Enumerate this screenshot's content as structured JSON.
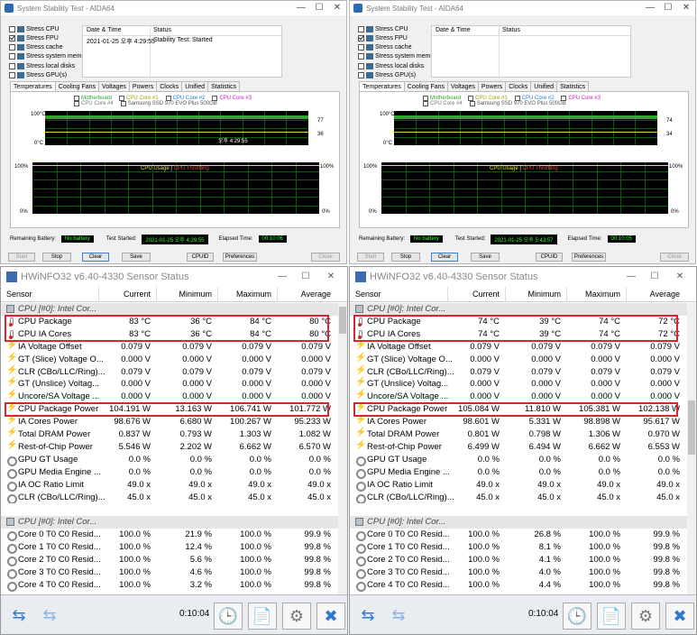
{
  "aida": {
    "title": "System Stability Test - AIDA64",
    "win_min": "—",
    "win_max": "☐",
    "win_close": "✕",
    "options": [
      "Stress CPU",
      "Stress FPU",
      "Stress cache",
      "Stress system memory",
      "Stress local disks",
      "Stress GPU(s)"
    ],
    "options_checked": [
      false,
      true,
      false,
      false,
      false,
      false
    ],
    "log_headers": {
      "date": "Date & Time",
      "status": "Status"
    },
    "tabs": [
      "Temperatures",
      "Cooling Fans",
      "Voltages",
      "Powers",
      "Clocks",
      "Unified",
      "Statistics"
    ],
    "legend": [
      "Motherboard",
      "CPU Core #1",
      "CPU Core #2",
      "CPU Core #3",
      "CPU Core #4",
      "Samsung SSD 970 EVO Plus 500GB"
    ],
    "legend_colors": [
      "#2e9d2e",
      "#9f9f00",
      "#1e7fd0",
      "#c020c0",
      "#777777",
      "#555555"
    ],
    "graph1_top": "100°C",
    "graph1_bottom": "0°C",
    "graph2_title_a": "CPU Usage",
    "graph2_sep": " | ",
    "graph2_title_b": "CPU Throttling",
    "graph2_top_left": "100%",
    "graph2_bottom_left": "0%",
    "graph2_top_right": "100%",
    "graph2_bottom_right": "0%",
    "labels": {
      "battery": "Remaining Battery:",
      "started": "Test Started:",
      "elapsed": "Elapsed Time:"
    },
    "buttons": [
      "Start",
      "Stop",
      "Clear",
      "Save",
      "CPUID",
      "Preferences",
      "Close"
    ],
    "left": {
      "log_date": "2021-01-25 오후 4:29:55",
      "log_status": "Stability Test: Started",
      "readout_a": "77",
      "readout_b": "36",
      "time_marker": "오후 4:29:55",
      "battery": "No battery",
      "started": "2021-01-25 오후 4:29:55",
      "elapsed": "00:10:06"
    },
    "right": {
      "log_date": "",
      "log_status": "",
      "readout_a": "74",
      "readout_b": "34",
      "time_marker": "",
      "battery": "No battery",
      "started": "2021-01-25 오후 5:43:57",
      "elapsed": "00:10:05"
    }
  },
  "hw": {
    "title": "HWiNFO32 v6.40-4330 Sensor Status",
    "win_min": "—",
    "win_max": "☐",
    "win_close": "✕",
    "headers": {
      "sensor": "Sensor",
      "current": "Current",
      "minimum": "Minimum",
      "maximum": "Maximum",
      "average": "Average"
    },
    "footer_nav": "⇆",
    "footer_nav2": "⇆",
    "footer_clock": "🕒",
    "footer_report": "📄",
    "footer_gear": "⚙",
    "footer_close": "✖",
    "left": {
      "timer": "0:10:04",
      "rows": [
        {
          "t": "group",
          "name": "CPU [#0]: Intel Cor..."
        },
        {
          "t": "therm",
          "name": "CPU Package",
          "cur": "83 °C",
          "min": "36 °C",
          "max": "84 °C",
          "avg": "80 °C"
        },
        {
          "t": "therm",
          "name": "CPU IA Cores",
          "cur": "83 °C",
          "min": "36 °C",
          "max": "84 °C",
          "avg": "80 °C"
        },
        {
          "t": "bolt",
          "name": "IA Voltage Offset",
          "cur": "0.079 V",
          "min": "0.079 V",
          "max": "0.079 V",
          "avg": "0.079 V"
        },
        {
          "t": "bolt",
          "name": "GT (Slice) Voltage O...",
          "cur": "0.000 V",
          "min": "0.000 V",
          "max": "0.000 V",
          "avg": "0.000 V"
        },
        {
          "t": "bolt",
          "name": "CLR (CBo/LLC/Ring)...",
          "cur": "0.079 V",
          "min": "0.079 V",
          "max": "0.079 V",
          "avg": "0.079 V"
        },
        {
          "t": "bolt",
          "name": "GT (Unslice) Voltag...",
          "cur": "0.000 V",
          "min": "0.000 V",
          "max": "0.000 V",
          "avg": "0.000 V"
        },
        {
          "t": "bolt",
          "name": "Uncore/SA Voltage ...",
          "cur": "0.000 V",
          "min": "0.000 V",
          "max": "0.000 V",
          "avg": "0.000 V"
        },
        {
          "t": "bolt",
          "name": "CPU Package Power",
          "cur": "104.191 W",
          "min": "13.163 W",
          "max": "106.741 W",
          "avg": "101.772 W"
        },
        {
          "t": "bolt",
          "name": "IA Cores Power",
          "cur": "98.676 W",
          "min": "6.680 W",
          "max": "100.267 W",
          "avg": "95.233 W"
        },
        {
          "t": "bolt",
          "name": "Total DRAM Power",
          "cur": "0.837 W",
          "min": "0.793 W",
          "max": "1.303 W",
          "avg": "1.082 W"
        },
        {
          "t": "bolt",
          "name": "Rest-of-Chip Power",
          "cur": "5.546 W",
          "min": "2.202 W",
          "max": "6.662 W",
          "avg": "6.570 W"
        },
        {
          "t": "gear",
          "name": "GPU GT Usage",
          "cur": "0.0 %",
          "min": "0.0 %",
          "max": "0.0 %",
          "avg": "0.0 %"
        },
        {
          "t": "gear",
          "name": "GPU Media Engine ...",
          "cur": "0.0 %",
          "min": "0.0 %",
          "max": "0.0 %",
          "avg": "0.0 %"
        },
        {
          "t": "gear",
          "name": "IA OC Ratio Limit",
          "cur": "49.0 x",
          "min": "49.0 x",
          "max": "49.0 x",
          "avg": "49.0 x"
        },
        {
          "t": "gear",
          "name": "CLR (CBo/LLC/Ring)...",
          "cur": "45.0 x",
          "min": "45.0 x",
          "max": "45.0 x",
          "avg": "45.0 x"
        },
        {
          "t": "blank",
          "name": ""
        },
        {
          "t": "group",
          "name": "CPU [#0]: Intel Cor..."
        },
        {
          "t": "gear",
          "name": "Core 0 T0 C0 Resid...",
          "cur": "100.0 %",
          "min": "21.9 %",
          "max": "100.0 %",
          "avg": "99.9 %"
        },
        {
          "t": "gear",
          "name": "Core 1 T0 C0 Resid...",
          "cur": "100.0 %",
          "min": "12.4 %",
          "max": "100.0 %",
          "avg": "99.8 %"
        },
        {
          "t": "gear",
          "name": "Core 2 T0 C0 Resid...",
          "cur": "100.0 %",
          "min": "5.6 %",
          "max": "100.0 %",
          "avg": "99.8 %"
        },
        {
          "t": "gear",
          "name": "Core 3 T0 C0 Resid...",
          "cur": "100.0 %",
          "min": "4.6 %",
          "max": "100.0 %",
          "avg": "99.8 %"
        },
        {
          "t": "gear",
          "name": "Core 4 T0 C0 Resid...",
          "cur": "100.0 %",
          "min": "3.2 %",
          "max": "100.0 %",
          "avg": "99.8 %"
        }
      ]
    },
    "right": {
      "timer": "0:10:04",
      "rows": [
        {
          "t": "group",
          "name": "CPU [#0]: Intel Cor..."
        },
        {
          "t": "therm",
          "name": "CPU Package",
          "cur": "74 °C",
          "min": "39 °C",
          "max": "74 °C",
          "avg": "72 °C"
        },
        {
          "t": "therm",
          "name": "CPU IA Cores",
          "cur": "74 °C",
          "min": "39 °C",
          "max": "74 °C",
          "avg": "72 °C"
        },
        {
          "t": "bolt",
          "name": "IA Voltage Offset",
          "cur": "0.079 V",
          "min": "0.079 V",
          "max": "0.079 V",
          "avg": "0.079 V"
        },
        {
          "t": "bolt",
          "name": "GT (Slice) Voltage O...",
          "cur": "0.000 V",
          "min": "0.000 V",
          "max": "0.000 V",
          "avg": "0.000 V"
        },
        {
          "t": "bolt",
          "name": "CLR (CBo/LLC/Ring)...",
          "cur": "0.079 V",
          "min": "0.079 V",
          "max": "0.079 V",
          "avg": "0.079 V"
        },
        {
          "t": "bolt",
          "name": "GT (Unslice) Voltag...",
          "cur": "0.000 V",
          "min": "0.000 V",
          "max": "0.000 V",
          "avg": "0.000 V"
        },
        {
          "t": "bolt",
          "name": "Uncore/SA Voltage ...",
          "cur": "0.000 V",
          "min": "0.000 V",
          "max": "0.000 V",
          "avg": "0.000 V"
        },
        {
          "t": "bolt",
          "name": "CPU Package Power",
          "cur": "105.084 W",
          "min": "11.810 W",
          "max": "105.381 W",
          "avg": "102.138 W"
        },
        {
          "t": "bolt",
          "name": "IA Cores Power",
          "cur": "98.601 W",
          "min": "5.331 W",
          "max": "98.898 W",
          "avg": "95.617 W"
        },
        {
          "t": "bolt",
          "name": "Total DRAM Power",
          "cur": "0.801 W",
          "min": "0.798 W",
          "max": "1.306 W",
          "avg": "0.970 W"
        },
        {
          "t": "bolt",
          "name": "Rest-of-Chip Power",
          "cur": "6.499 W",
          "min": "6.494 W",
          "max": "6.662 W",
          "avg": "6.553 W"
        },
        {
          "t": "gear",
          "name": "GPU GT Usage",
          "cur": "0.0 %",
          "min": "0.0 %",
          "max": "0.0 %",
          "avg": "0.0 %"
        },
        {
          "t": "gear",
          "name": "GPU Media Engine ...",
          "cur": "0.0 %",
          "min": "0.0 %",
          "max": "0.0 %",
          "avg": "0.0 %"
        },
        {
          "t": "gear",
          "name": "IA OC Ratio Limit",
          "cur": "49.0 x",
          "min": "49.0 x",
          "max": "49.0 x",
          "avg": "49.0 x"
        },
        {
          "t": "gear",
          "name": "CLR (CBo/LLC/Ring)...",
          "cur": "45.0 x",
          "min": "45.0 x",
          "max": "45.0 x",
          "avg": "45.0 x"
        },
        {
          "t": "blank",
          "name": ""
        },
        {
          "t": "group",
          "name": "CPU [#0]: Intel Cor..."
        },
        {
          "t": "gear",
          "name": "Core 0 T0 C0 Resid...",
          "cur": "100.0 %",
          "min": "26.8 %",
          "max": "100.0 %",
          "avg": "99.9 %"
        },
        {
          "t": "gear",
          "name": "Core 1 T0 C0 Resid...",
          "cur": "100.0 %",
          "min": "8.1 %",
          "max": "100.0 %",
          "avg": "99.8 %"
        },
        {
          "t": "gear",
          "name": "Core 2 T0 C0 Resid...",
          "cur": "100.0 %",
          "min": "4.1 %",
          "max": "100.0 %",
          "avg": "99.8 %"
        },
        {
          "t": "gear",
          "name": "Core 3 T0 C0 Resid...",
          "cur": "100.0 %",
          "min": "4.0 %",
          "max": "100.0 %",
          "avg": "99.8 %"
        },
        {
          "t": "gear",
          "name": "Core 4 T0 C0 Resid...",
          "cur": "100.0 %",
          "min": "4.4 %",
          "max": "100.0 %",
          "avg": "99.8 %"
        }
      ]
    }
  }
}
